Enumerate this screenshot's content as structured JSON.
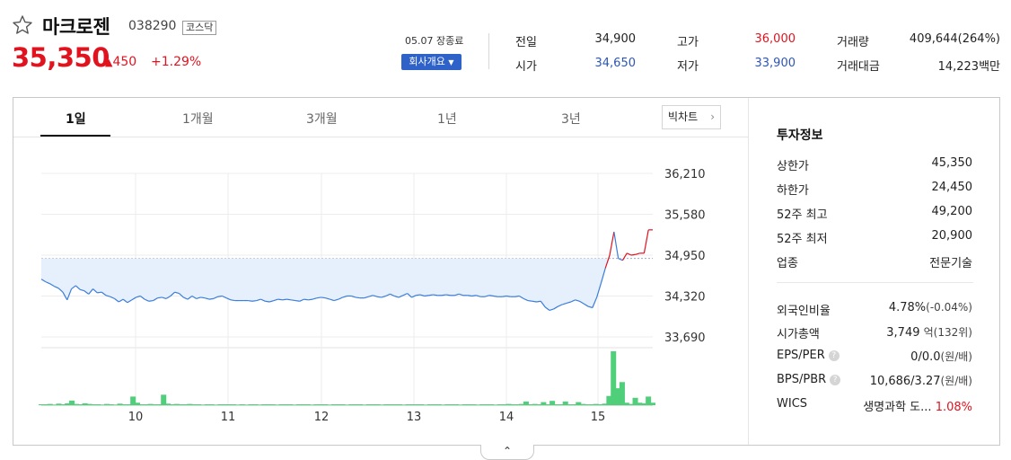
{
  "stock": {
    "name": "마크로젠",
    "code": "038290",
    "market": "코스닥",
    "price": "35,350",
    "change": "450",
    "change_pct": "+1.29%",
    "close_label": "05.07 장종료",
    "company_btn": "회사개요"
  },
  "quote": {
    "prev_label": "전일",
    "prev": "34,900",
    "open_label": "시가",
    "open": "34,650",
    "high_label": "고가",
    "high": "36,000",
    "low_label": "저가",
    "low": "33,900",
    "vol_label": "거래량",
    "vol": "409,644(264%)",
    "amt_label": "거래대금",
    "amt": "14,223백만"
  },
  "tabs": [
    "1일",
    "1개월",
    "3개월",
    "1년",
    "3년"
  ],
  "big_chart": "빅차트",
  "chart_data": {
    "type": "line",
    "x_ticks": [
      "10",
      "11",
      "12",
      "13",
      "14",
      "15"
    ],
    "y_ticks": [
      "36,210",
      "35,580",
      "34,950",
      "34,320",
      "33,690"
    ],
    "ylim": [
      33690,
      36210
    ],
    "reference_value": 34900,
    "price": [
      34580,
      34540,
      34510,
      34470,
      34440,
      34380,
      34260,
      34430,
      34480,
      34420,
      34400,
      34350,
      34430,
      34370,
      34380,
      34330,
      34310,
      34280,
      34230,
      34270,
      34220,
      34260,
      34300,
      34320,
      34270,
      34240,
      34250,
      34290,
      34300,
      34280,
      34320,
      34380,
      34360,
      34300,
      34270,
      34320,
      34280,
      34300,
      34290,
      34270,
      34280,
      34310,
      34320,
      34290,
      34260,
      34250,
      34250,
      34250,
      34250,
      34240,
      34250,
      34270,
      34240,
      34230,
      34250,
      34270,
      34260,
      34270,
      34260,
      34250,
      34240,
      34270,
      34260,
      34270,
      34290,
      34300,
      34290,
      34270,
      34250,
      34270,
      34300,
      34320,
      34320,
      34300,
      34290,
      34290,
      34310,
      34330,
      34310,
      34300,
      34320,
      34350,
      34320,
      34300,
      34330,
      34360,
      34300,
      34330,
      34340,
      34320,
      34330,
      34340,
      34330,
      34330,
      34340,
      34330,
      34330,
      34350,
      34330,
      34330,
      34320,
      34330,
      34310,
      34310,
      34330,
      34320,
      34310,
      34310,
      34320,
      34310,
      34310,
      34320,
      34280,
      34250,
      34240,
      34230,
      34240,
      34150,
      34100,
      34120,
      34160,
      34190,
      34210,
      34230,
      34260,
      34240,
      34200,
      34160,
      34140,
      34300,
      34520,
      34750,
      34950,
      35310,
      34900,
      34870,
      34980,
      34950,
      34960,
      34980,
      34980,
      35340,
      35340
    ],
    "volume": [
      3,
      3,
      4,
      2,
      5,
      3,
      6,
      15,
      4,
      3,
      6,
      4,
      3,
      3,
      2,
      4,
      3,
      2,
      5,
      3,
      3,
      28,
      8,
      3,
      3,
      4,
      3,
      3,
      34,
      5,
      3,
      4,
      3,
      3,
      4,
      3,
      3,
      2,
      3,
      3,
      2,
      3,
      3,
      3,
      3,
      2,
      3,
      2,
      3,
      3,
      2,
      3,
      3,
      3,
      2,
      3,
      3,
      3,
      2,
      3,
      3,
      3,
      2,
      3,
      3,
      3,
      2,
      3,
      3,
      3,
      2,
      3,
      3,
      3,
      2,
      3,
      3,
      3,
      2,
      3,
      3,
      3,
      3,
      2,
      3,
      3,
      3,
      3,
      2,
      3,
      3,
      3,
      2,
      3,
      3,
      3,
      2,
      3,
      3,
      3,
      2,
      3,
      3,
      3,
      2,
      3,
      3,
      4,
      3,
      3,
      4,
      12,
      3,
      4,
      3,
      10,
      3,
      14,
      3,
      3,
      12,
      3,
      3,
      10,
      4,
      3,
      3,
      4,
      3,
      5,
      30,
      175,
      55,
      75,
      8,
      4,
      24,
      8,
      6,
      28,
      8
    ]
  },
  "invest": {
    "title": "투자정보",
    "rows": [
      {
        "label": "상한가",
        "value": "45,350"
      },
      {
        "label": "하한가",
        "value": "24,450"
      },
      {
        "label": "52주 최고",
        "value": "49,200"
      },
      {
        "label": "52주 최저",
        "value": "20,900"
      },
      {
        "label": "업종",
        "value": "전문기술"
      }
    ],
    "rows2": [
      {
        "label": "외국인비율",
        "value": "4.78%",
        "sub": "(-0.04%)"
      },
      {
        "label": "시가총액",
        "value": "3,749",
        "sub": "억(132위)"
      },
      {
        "label": "EPS/PER",
        "value": "0/0.0",
        "sub": "(원/배)"
      },
      {
        "label": "BPS/PBR",
        "value": "10,686/3.27",
        "sub": "(원/배)"
      },
      {
        "label": "WICS",
        "value": "생명과학 도...",
        "sub": "1.08%"
      }
    ]
  }
}
